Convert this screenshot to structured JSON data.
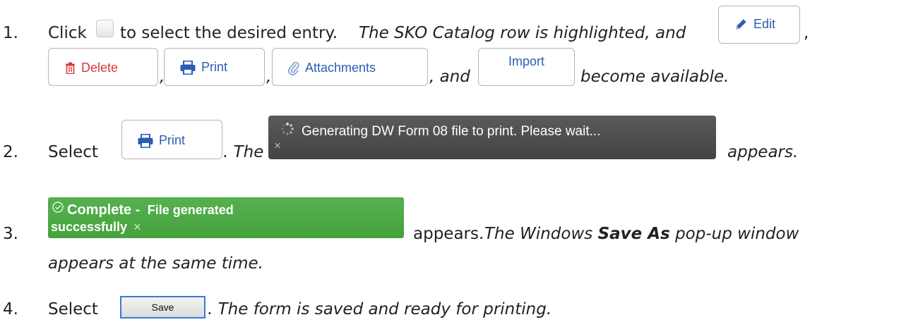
{
  "steps": [
    {
      "num": "1.",
      "click": "Click",
      "select_text": "to select the desired entry.",
      "italic_a": "The SKO Catalog row is highlighted, and",
      "comma": ",",
      "and": ", and",
      "italic_b": "become available."
    },
    {
      "num": "2.",
      "select": "Select",
      "the": ". The",
      "appears": "appears."
    },
    {
      "num": "3.",
      "appears": "appears.",
      "italic_a": "The Windows",
      "bold": "Save As",
      "italic_b": "pop-up window",
      "line2": "appears at the same time."
    },
    {
      "num": "4.",
      "select": "Select",
      "italic": ". The form is saved and ready for printing."
    }
  ],
  "buttons": {
    "edit": "Edit",
    "delete": "Delete",
    "print": "Print",
    "attachments": "Attachments",
    "import": "Import",
    "save": "Save"
  },
  "toasts": {
    "generating": "Generating DW Form 08 file to print. Please wait...",
    "close": "×",
    "complete_bold": "Complete -",
    "complete_rest": "File generated",
    "complete_line2": "successfully"
  },
  "icons": [
    "checkbox-icon",
    "pencil-icon",
    "trash-icon",
    "printer-icon",
    "paperclip-icon",
    "spinner-icon",
    "close-icon",
    "check-circle-icon"
  ],
  "colors": {
    "primary_blue": "#2b5db4",
    "danger_red": "#d9373c",
    "success_green": "#4caa44",
    "toast_dark": "#4e4e4e"
  }
}
